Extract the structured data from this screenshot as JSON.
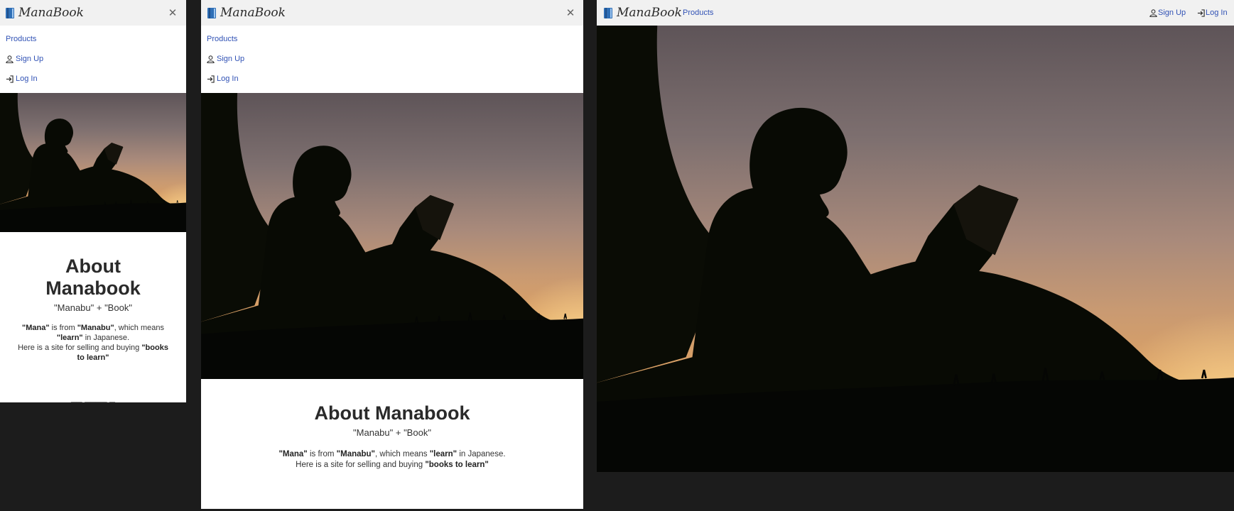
{
  "brand": {
    "name": "ManaBook"
  },
  "nav": {
    "products": "Products",
    "signup": "Sign Up",
    "login": "Log In"
  },
  "about": {
    "title": "About Manabook",
    "subtitle": "\"Manabu\" + \"Book\"",
    "mana": "\"Mana\"",
    "is_from": " is from ",
    "manabu": "\"Manabu\"",
    "which_means": ", which means ",
    "learn": "\"learn\"",
    "in_japanese": " in Japanese.",
    "here_is": "Here is a site for selling and buying ",
    "books_to_learn": "\"books to learn\""
  },
  "colors": {
    "link": "#3152b5",
    "navbar": "#f1f1f1",
    "backdrop": "#1c1c1c"
  },
  "icons": {
    "brand": "blue-book-icon",
    "close": "close-icon",
    "signup": "person-icon",
    "login": "login-arrow-icon"
  }
}
